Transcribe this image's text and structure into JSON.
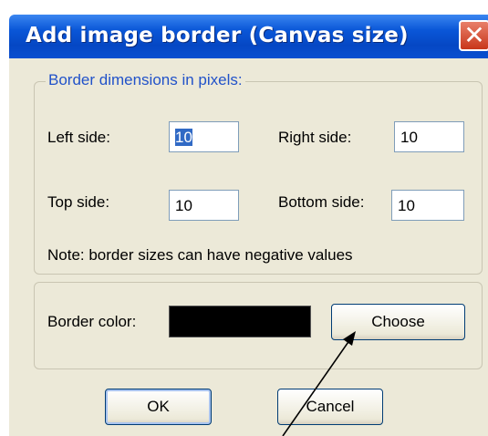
{
  "dialog": {
    "title": "Add image border (Canvas size)",
    "close_glyph": "✕"
  },
  "dimensions_group": {
    "legend": "Border dimensions in pixels:",
    "left_label": "Left side:",
    "left_value": "10",
    "right_label": "Right side:",
    "right_value": "10",
    "top_label": "Top side:",
    "top_value": "10",
    "bottom_label": "Bottom side:",
    "bottom_value": "10",
    "note": "Note: border sizes can have negative values"
  },
  "color_group": {
    "label": "Border color:",
    "color": "#000000",
    "choose_label": "Choose"
  },
  "buttons": {
    "ok": "OK",
    "cancel": "Cancel"
  }
}
